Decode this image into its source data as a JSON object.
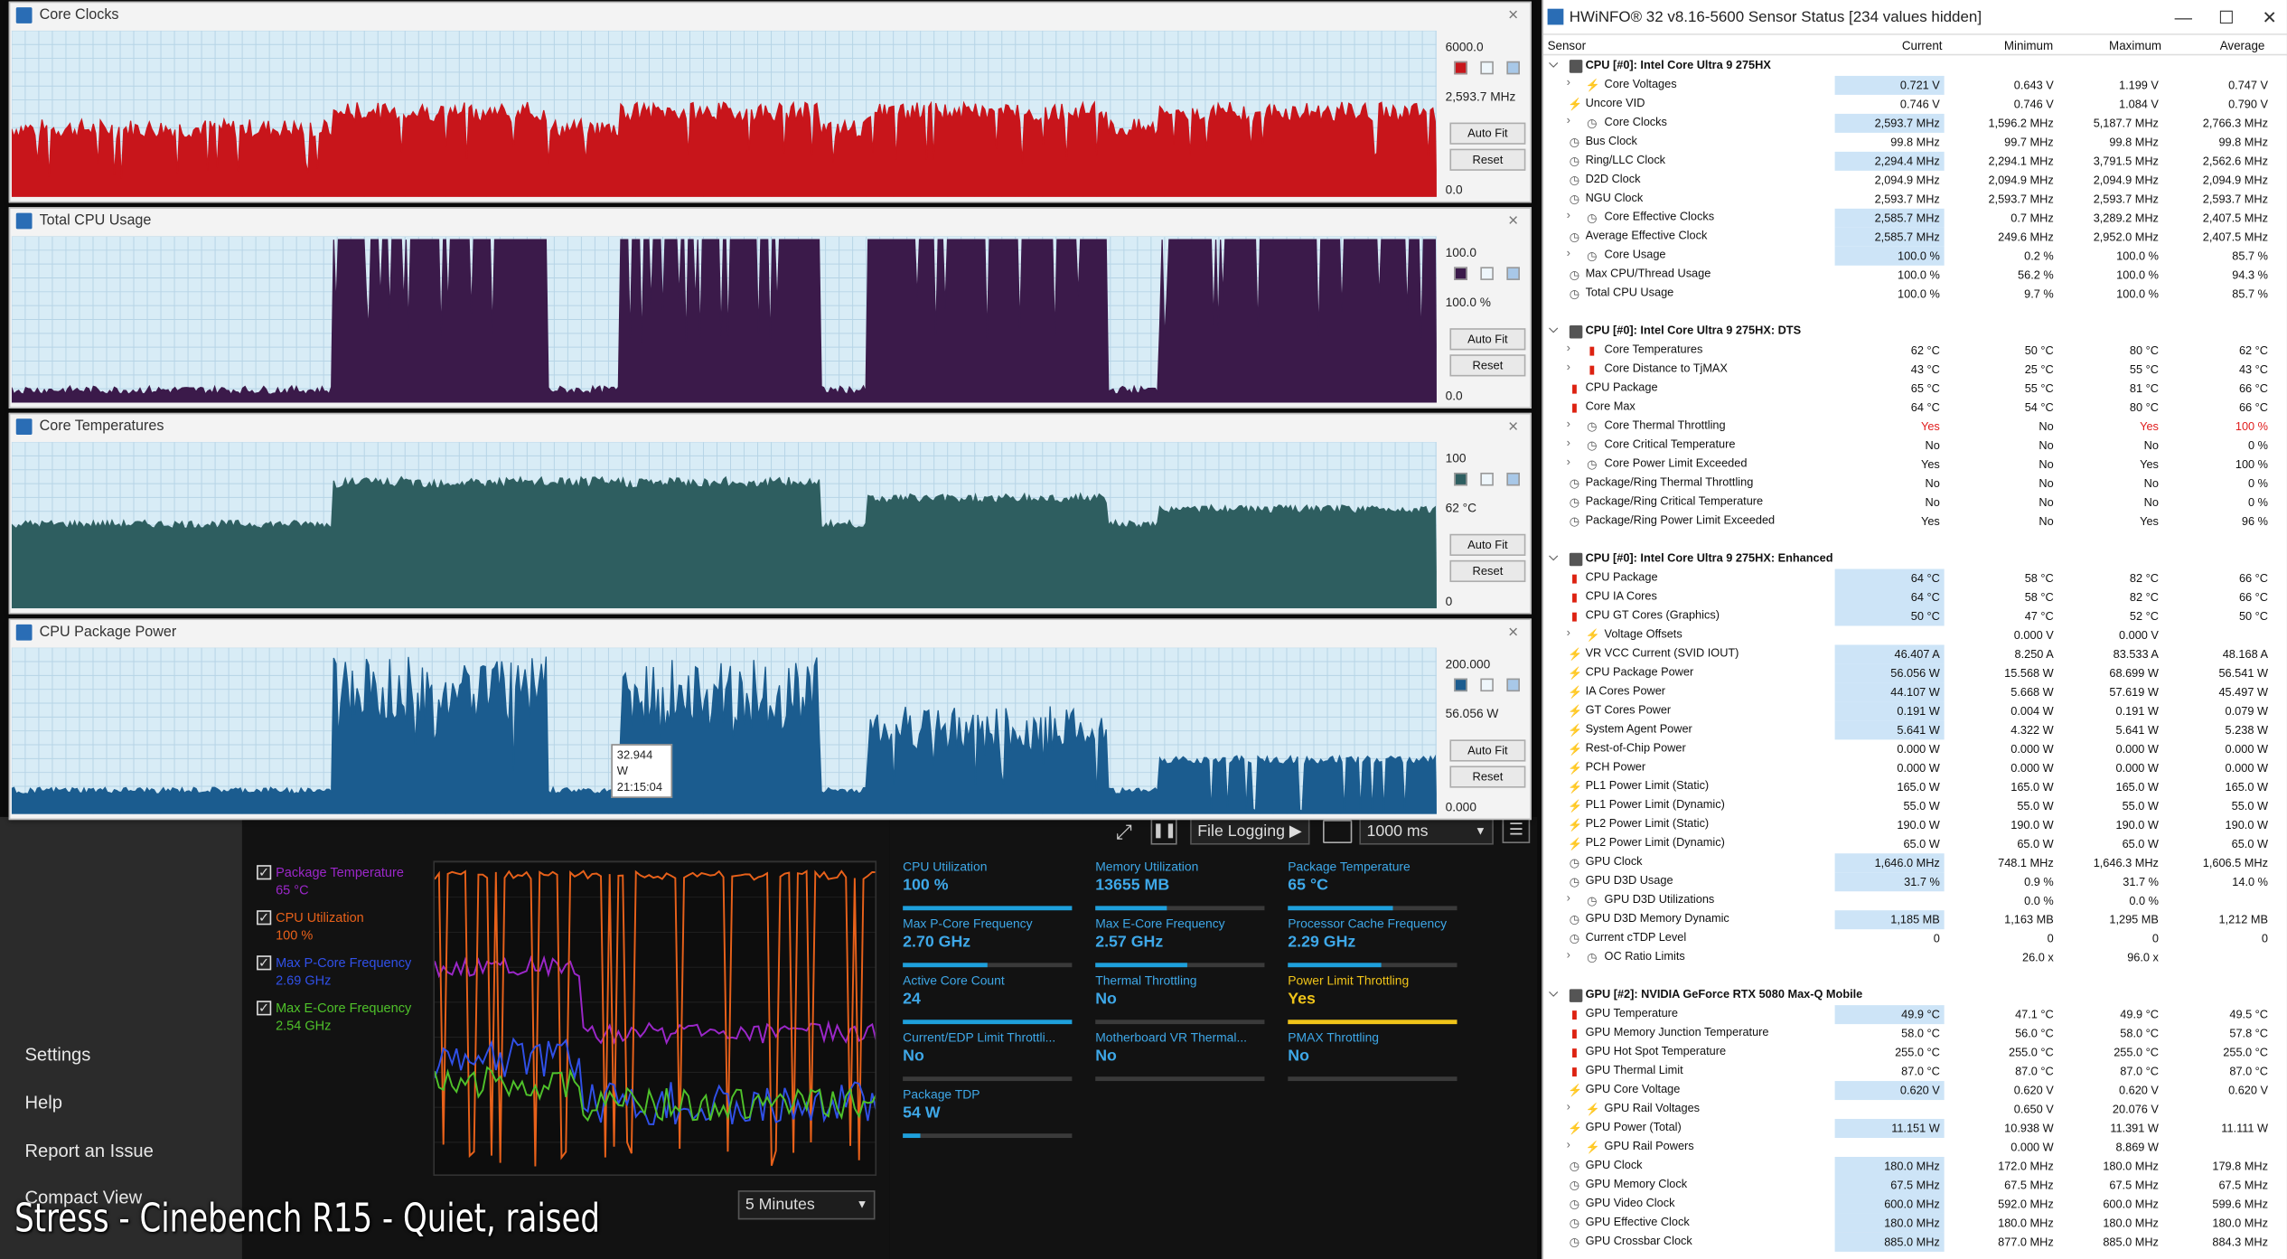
{
  "caption": "Stress - Cinebench R15 - Quiet, raised",
  "colors": {
    "clocks": "#c8151b",
    "usage": "#3b1a4a",
    "temp": "#2e5e60",
    "power": "#1b5c8f",
    "accent": "#1ea0dc",
    "warn": "#f0c419"
  },
  "graph_windows": [
    {
      "title": "Core Clocks",
      "max": "6000.0",
      "current": "2,593.7 MHz",
      "min": "0.0",
      "auto_fit": "Auto Fit",
      "reset": "Reset",
      "close": "×"
    },
    {
      "title": "Total CPU Usage",
      "max": "100.0",
      "current": "100.0 %",
      "min": "0.0",
      "auto_fit": "Auto Fit",
      "reset": "Reset",
      "close": "×"
    },
    {
      "title": "Core Temperatures",
      "max": "100",
      "current": "62 °C",
      "min": "0",
      "auto_fit": "Auto Fit",
      "reset": "Reset",
      "close": "×"
    },
    {
      "title": "CPU Package Power",
      "max": "200.000",
      "current": "56.056 W",
      "min": "0.000",
      "auto_fit": "Auto Fit",
      "reset": "Reset",
      "close": "×",
      "tooltip_value": "32.944 W",
      "tooltip_time": "21:15:04"
    }
  ],
  "xtu": {
    "nav": [
      "Settings",
      "Help",
      "Report an Issue",
      "Compact View"
    ],
    "legend": [
      {
        "label": "Package Temperature",
        "value": "65 °C",
        "color": "#9b27c9"
      },
      {
        "label": "CPU Utilization",
        "value": "100 %",
        "color": "#e8611a"
      },
      {
        "label": "Max P-Core Frequency",
        "value": "2.69 GHz",
        "color": "#3050e8"
      },
      {
        "label": "Max E-Core Frequency",
        "value": "2.54 GHz",
        "color": "#4fc12a"
      }
    ],
    "timespan": "5 Minutes",
    "file_logging": "File Logging ▶",
    "interval": "1000 ms",
    "metrics": [
      {
        "label": "CPU Utilization",
        "value": "100 %",
        "fill": 1.0
      },
      {
        "label": "Memory Utilization",
        "value": "13655 MB",
        "fill": 0.42
      },
      {
        "label": "Package Temperature",
        "value": "65 °C",
        "fill": 0.62
      },
      {
        "label": "Max P-Core Frequency",
        "value": "2.70 GHz",
        "fill": 0.5
      },
      {
        "label": "Max E-Core Frequency",
        "value": "2.57 GHz",
        "fill": 0.54
      },
      {
        "label": "Processor Cache Frequency",
        "value": "2.29 GHz",
        "fill": 0.55
      },
      {
        "label": "Active Core Count",
        "value": "24",
        "fill": 1.0
      },
      {
        "label": "Thermal Throttling",
        "value": "No",
        "fill": 0
      },
      {
        "label": "Power Limit Throttling",
        "value": "Yes",
        "fill": 1.0,
        "warn": true
      },
      {
        "label": "Current/EDP Limit Throttli...",
        "value": "No",
        "fill": 0
      },
      {
        "label": "Motherboard VR Thermal...",
        "value": "No",
        "fill": 0
      },
      {
        "label": "PMAX Throttling",
        "value": "No",
        "fill": 0
      },
      {
        "label": "Package TDP",
        "value": "54 W",
        "fill": 0.1
      }
    ]
  },
  "hwinfo": {
    "title": "HWiNFO® 32 v8.16-5600 Sensor Status [234 values hidden]",
    "columns": [
      "Sensor",
      "Current",
      "Minimum",
      "Maximum",
      "Average"
    ],
    "rows": [
      {
        "g": 1,
        "n": "CPU [#0]: Intel Core Ultra 9 275HX"
      },
      {
        "n": "Core Voltages",
        "i": "v",
        "e": 1,
        "c": "0.721 V",
        "mn": "0.643 V",
        "mx": "1.199 V",
        "a": "0.747 V",
        "h": 1
      },
      {
        "n": "Uncore VID",
        "i": "v",
        "c": "0.746 V",
        "mn": "0.746 V",
        "mx": "1.084 V",
        "a": "0.790 V"
      },
      {
        "n": "Core Clocks",
        "i": "c",
        "e": 1,
        "c": "2,593.7 MHz",
        "mn": "1,596.2 MHz",
        "mx": "5,187.7 MHz",
        "a": "2,766.3 MHz",
        "h": 1
      },
      {
        "n": "Bus Clock",
        "i": "c",
        "c": "99.8 MHz",
        "mn": "99.7 MHz",
        "mx": "99.8 MHz",
        "a": "99.8 MHz"
      },
      {
        "n": "Ring/LLC Clock",
        "i": "c",
        "c": "2,294.4 MHz",
        "mn": "2,294.1 MHz",
        "mx": "3,791.5 MHz",
        "a": "2,562.6 MHz",
        "h": 1
      },
      {
        "n": "D2D Clock",
        "i": "c",
        "c": "2,094.9 MHz",
        "mn": "2,094.9 MHz",
        "mx": "2,094.9 MHz",
        "a": "2,094.9 MHz"
      },
      {
        "n": "NGU Clock",
        "i": "c",
        "c": "2,593.7 MHz",
        "mn": "2,593.7 MHz",
        "mx": "2,593.7 MHz",
        "a": "2,593.7 MHz"
      },
      {
        "n": "Core Effective Clocks",
        "i": "c",
        "e": 1,
        "c": "2,585.7 MHz",
        "mn": "0.7 MHz",
        "mx": "3,289.2 MHz",
        "a": "2,407.5 MHz",
        "h": 1
      },
      {
        "n": "Average Effective Clock",
        "i": "c",
        "c": "2,585.7 MHz",
        "mn": "249.6 MHz",
        "mx": "2,952.0 MHz",
        "a": "2,407.5 MHz",
        "h": 1
      },
      {
        "n": "Core Usage",
        "i": "c",
        "e": 1,
        "c": "100.0 %",
        "mn": "0.2 %",
        "mx": "100.0 %",
        "a": "85.7 %",
        "h": 1
      },
      {
        "n": "Max CPU/Thread Usage",
        "i": "c",
        "c": "100.0 %",
        "mn": "56.2 %",
        "mx": "100.0 %",
        "a": "94.3 %"
      },
      {
        "n": "Total CPU Usage",
        "i": "c",
        "c": "100.0 %",
        "mn": "9.7 %",
        "mx": "100.0 %",
        "a": "85.7 %"
      },
      {
        "b": 1
      },
      {
        "g": 1,
        "n": "CPU [#0]: Intel Core Ultra 9 275HX: DTS"
      },
      {
        "n": "Core Temperatures",
        "i": "t",
        "e": 1,
        "c": "62 °C",
        "mn": "50 °C",
        "mx": "80 °C",
        "a": "62 °C"
      },
      {
        "n": "Core Distance to TjMAX",
        "i": "t",
        "e": 1,
        "c": "43 °C",
        "mn": "25 °C",
        "mx": "55 °C",
        "a": "43 °C"
      },
      {
        "n": "CPU Package",
        "i": "t",
        "c": "65 °C",
        "mn": "55 °C",
        "mx": "81 °C",
        "a": "66 °C"
      },
      {
        "n": "Core Max",
        "i": "t",
        "c": "64 °C",
        "mn": "54 °C",
        "mx": "80 °C",
        "a": "66 °C"
      },
      {
        "n": "Core Thermal Throttling",
        "i": "c",
        "e": 1,
        "c": "Yes",
        "mn": "No",
        "mx": "Yes",
        "a": "100 %",
        "r": 1
      },
      {
        "n": "Core Critical Temperature",
        "i": "c",
        "e": 1,
        "c": "No",
        "mn": "No",
        "mx": "No",
        "a": "0 %"
      },
      {
        "n": "Core Power Limit Exceeded",
        "i": "c",
        "e": 1,
        "c": "Yes",
        "mn": "No",
        "mx": "Yes",
        "a": "100 %"
      },
      {
        "n": "Package/Ring Thermal Throttling",
        "i": "c",
        "c": "No",
        "mn": "No",
        "mx": "No",
        "a": "0 %"
      },
      {
        "n": "Package/Ring Critical Temperature",
        "i": "c",
        "c": "No",
        "mn": "No",
        "mx": "No",
        "a": "0 %"
      },
      {
        "n": "Package/Ring Power Limit Exceeded",
        "i": "c",
        "c": "Yes",
        "mn": "No",
        "mx": "Yes",
        "a": "96 %"
      },
      {
        "b": 1
      },
      {
        "g": 1,
        "n": "CPU [#0]: Intel Core Ultra 9 275HX: Enhanced"
      },
      {
        "n": "CPU Package",
        "i": "t",
        "c": "64 °C",
        "mn": "58 °C",
        "mx": "82 °C",
        "a": "66 °C",
        "h": 1
      },
      {
        "n": "CPU IA Cores",
        "i": "t",
        "c": "64 °C",
        "mn": "58 °C",
        "mx": "82 °C",
        "a": "66 °C",
        "h": 1
      },
      {
        "n": "CPU GT Cores (Graphics)",
        "i": "t",
        "c": "50 °C",
        "mn": "47 °C",
        "mx": "52 °C",
        "a": "50 °C",
        "h": 1
      },
      {
        "n": "Voltage Offsets",
        "i": "v",
        "e": 1,
        "c": "",
        "mn": "0.000 V",
        "mx": "0.000 V",
        "a": ""
      },
      {
        "n": "VR VCC Current (SVID IOUT)",
        "i": "v",
        "c": "46.407 A",
        "mn": "8.250 A",
        "mx": "83.533 A",
        "a": "48.168 A",
        "h": 1
      },
      {
        "n": "CPU Package Power",
        "i": "v",
        "c": "56.056 W",
        "mn": "15.568 W",
        "mx": "68.699 W",
        "a": "56.541 W",
        "h": 1
      },
      {
        "n": "IA Cores Power",
        "i": "v",
        "c": "44.107 W",
        "mn": "5.668 W",
        "mx": "57.619 W",
        "a": "45.497 W",
        "h": 1
      },
      {
        "n": "GT Cores Power",
        "i": "v",
        "c": "0.191 W",
        "mn": "0.004 W",
        "mx": "0.191 W",
        "a": "0.079 W",
        "h": 1
      },
      {
        "n": "System Agent Power",
        "i": "v",
        "c": "5.641 W",
        "mn": "4.322 W",
        "mx": "5.641 W",
        "a": "5.238 W",
        "h": 1
      },
      {
        "n": "Rest-of-Chip Power",
        "i": "v",
        "c": "0.000 W",
        "mn": "0.000 W",
        "mx": "0.000 W",
        "a": "0.000 W"
      },
      {
        "n": "PCH Power",
        "i": "v",
        "c": "0.000 W",
        "mn": "0.000 W",
        "mx": "0.000 W",
        "a": "0.000 W"
      },
      {
        "n": "PL1 Power Limit (Static)",
        "i": "v",
        "c": "165.0 W",
        "mn": "165.0 W",
        "mx": "165.0 W",
        "a": "165.0 W"
      },
      {
        "n": "PL1 Power Limit (Dynamic)",
        "i": "v",
        "c": "55.0 W",
        "mn": "55.0 W",
        "mx": "55.0 W",
        "a": "55.0 W"
      },
      {
        "n": "PL2 Power Limit (Static)",
        "i": "v",
        "c": "190.0 W",
        "mn": "190.0 W",
        "mx": "190.0 W",
        "a": "190.0 W"
      },
      {
        "n": "PL2 Power Limit (Dynamic)",
        "i": "v",
        "c": "65.0 W",
        "mn": "65.0 W",
        "mx": "65.0 W",
        "a": "65.0 W"
      },
      {
        "n": "GPU Clock",
        "i": "c",
        "c": "1,646.0 MHz",
        "mn": "748.1 MHz",
        "mx": "1,646.3 MHz",
        "a": "1,606.5 MHz",
        "h": 1
      },
      {
        "n": "GPU D3D Usage",
        "i": "c",
        "c": "31.7 %",
        "mn": "0.9 %",
        "mx": "31.7 %",
        "a": "14.0 %",
        "h": 1
      },
      {
        "n": "GPU D3D Utilizations",
        "i": "c",
        "e": 1,
        "c": "",
        "mn": "0.0 %",
        "mx": "0.0 %",
        "a": ""
      },
      {
        "n": "GPU D3D Memory Dynamic",
        "i": "c",
        "c": "1,185 MB",
        "mn": "1,163 MB",
        "mx": "1,295 MB",
        "a": "1,212 MB",
        "h": 1
      },
      {
        "n": "Current cTDP Level",
        "i": "c",
        "c": "0",
        "mn": "0",
        "mx": "0",
        "a": "0"
      },
      {
        "n": "OC Ratio Limits",
        "i": "c",
        "e": 1,
        "c": "",
        "mn": "26.0 x",
        "mx": "96.0 x",
        "a": ""
      },
      {
        "b": 1
      },
      {
        "g": 1,
        "n": "GPU [#2]: NVIDIA  GeForce RTX 5080 Max-Q Mobile"
      },
      {
        "n": "GPU Temperature",
        "i": "t",
        "c": "49.9 °C",
        "mn": "47.1 °C",
        "mx": "49.9 °C",
        "a": "49.5 °C",
        "h": 1
      },
      {
        "n": "GPU Memory Junction Temperature",
        "i": "t",
        "c": "58.0 °C",
        "mn": "56.0 °C",
        "mx": "58.0 °C",
        "a": "57.8 °C"
      },
      {
        "n": "GPU Hot Spot Temperature",
        "i": "t",
        "c": "255.0 °C",
        "mn": "255.0 °C",
        "mx": "255.0 °C",
        "a": "255.0 °C"
      },
      {
        "n": "GPU Thermal Limit",
        "i": "t",
        "c": "87.0 °C",
        "mn": "87.0 °C",
        "mx": "87.0 °C",
        "a": "87.0 °C"
      },
      {
        "n": "GPU Core Voltage",
        "i": "v",
        "c": "0.620 V",
        "mn": "0.620 V",
        "mx": "0.620 V",
        "a": "0.620 V",
        "h": 1
      },
      {
        "n": "GPU Rail Voltages",
        "i": "v",
        "e": 1,
        "c": "",
        "mn": "0.650 V",
        "mx": "20.076 V",
        "a": ""
      },
      {
        "n": "GPU Power (Total)",
        "i": "v",
        "c": "11.151 W",
        "mn": "10.938 W",
        "mx": "11.391 W",
        "a": "11.111 W",
        "h": 1
      },
      {
        "n": "GPU Rail Powers",
        "i": "v",
        "e": 1,
        "c": "",
        "mn": "0.000 W",
        "mx": "8.869 W",
        "a": ""
      },
      {
        "n": "GPU Clock",
        "i": "c",
        "c": "180.0 MHz",
        "mn": "172.0 MHz",
        "mx": "180.0 MHz",
        "a": "179.8 MHz",
        "h": 1
      },
      {
        "n": "GPU Memory Clock",
        "i": "c",
        "c": "67.5 MHz",
        "mn": "67.5 MHz",
        "mx": "67.5 MHz",
        "a": "67.5 MHz",
        "h": 1
      },
      {
        "n": "GPU Video Clock",
        "i": "c",
        "c": "600.0 MHz",
        "mn": "592.0 MHz",
        "mx": "600.0 MHz",
        "a": "599.6 MHz",
        "h": 1
      },
      {
        "n": "GPU Effective Clock",
        "i": "c",
        "c": "180.0 MHz",
        "mn": "180.0 MHz",
        "mx": "180.0 MHz",
        "a": "180.0 MHz",
        "h": 1
      },
      {
        "n": "GPU Crossbar Clock",
        "i": "c",
        "c": "885.0 MHz",
        "mn": "877.0 MHz",
        "mx": "885.0 MHz",
        "a": "884.3 MHz",
        "h": 1
      }
    ]
  }
}
